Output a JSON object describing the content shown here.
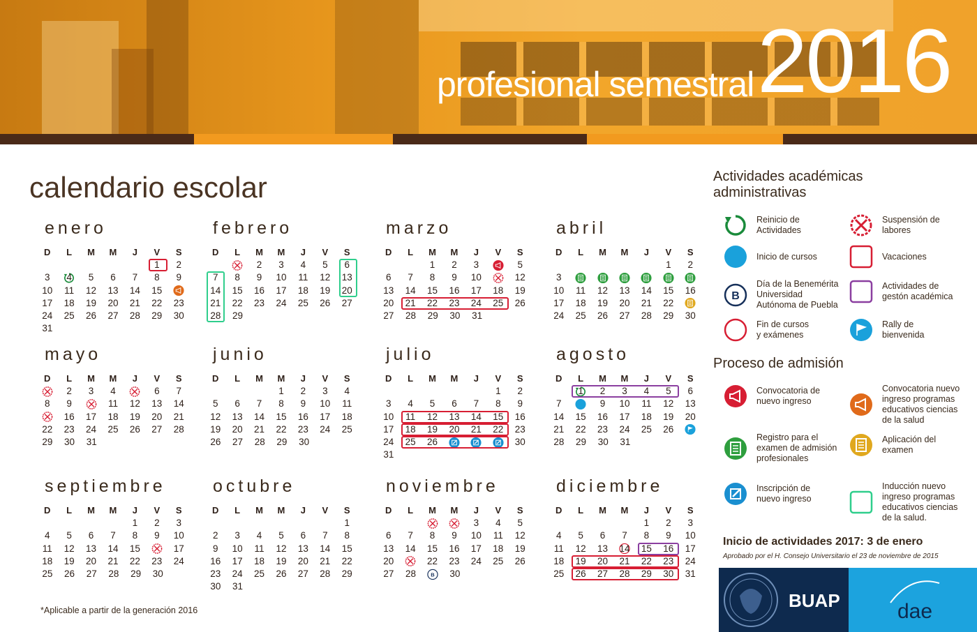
{
  "header": {
    "subtitle": "profesional semestral",
    "year": "2016"
  },
  "calendar_title": "calendario escolar",
  "weekday_headers": [
    "D",
    "L",
    "M",
    "M",
    "J",
    "V",
    "S"
  ],
  "colors": {
    "reinicio": "#1a8b3b",
    "inicio_cursos": "#1aa1db",
    "benemerita": "#16305a",
    "fin_cursos": "#d71e33",
    "suspension": "#d71e33",
    "vacaciones": "#d71e33",
    "gestion": "#8b3fa0",
    "rally": "#1aa1db",
    "convocatoria": "#d71e33",
    "convocatoria_salud": "#e06a1a",
    "registro": "#2e9e3e",
    "aplicacion": "#e0a81e",
    "inscripcion": "#1a8fd0",
    "induccion": "#2fce8c"
  },
  "months": [
    {
      "name": "enero",
      "start": 5,
      "days": 31,
      "marks": {
        "1": "vacaciones-box",
        "4": "reinicio",
        "16": "convocatoria_salud"
      }
    },
    {
      "name": "febrero",
      "start": 1,
      "days": 29,
      "marks": {
        "1": "suspension"
      }
    },
    {
      "name": "marzo",
      "start": 2,
      "days": 31,
      "marks": {
        "4": "convocatoria",
        "11": "suspension"
      }
    },
    {
      "name": "abril",
      "start": 5,
      "days": 30,
      "marks": {
        "4": "registro",
        "5": "registro",
        "6": "registro",
        "7": "registro",
        "8": "registro",
        "9": "registro",
        "23": "aplicacion"
      }
    },
    {
      "name": "mayo",
      "start": 0,
      "days": 31,
      "marks": {
        "1": "suspension",
        "5": "suspension",
        "10": "suspension",
        "15": "suspension"
      }
    },
    {
      "name": "junio",
      "start": 3,
      "days": 30,
      "marks": {}
    },
    {
      "name": "julio",
      "start": 5,
      "days": 31,
      "marks": {
        "27": "inscripcion",
        "28": "inscripcion",
        "29": "inscripcion"
      }
    },
    {
      "name": "agosto",
      "start": 1,
      "days": 31,
      "marks": {
        "1": "reinicio",
        "8": "inicio_cursos",
        "27": "rally"
      }
    },
    {
      "name": "septiembre",
      "start": 4,
      "days": 30,
      "marks": {
        "16": "suspension"
      }
    },
    {
      "name": "octubre",
      "start": 6,
      "days": 31,
      "marks": {}
    },
    {
      "name": "noviembre",
      "start": 2,
      "days": 30,
      "marks": {
        "1": "suspension",
        "2": "suspension",
        "21": "suspension",
        "29": "benemerita"
      }
    },
    {
      "name": "diciembre",
      "start": 4,
      "days": 31,
      "marks": {
        "14": "fin_cursos"
      }
    }
  ],
  "legend": {
    "title": "Actividades académicas administrativas",
    "items": [
      {
        "key": "reinicio",
        "label": "Reinicio de\nActividades",
        "icon": "restart-icon"
      },
      {
        "key": "suspension",
        "label": "Suspensión de\nlabores",
        "icon": "suspension-icon"
      },
      {
        "key": "inicio_cursos",
        "label": "Inicio de cursos",
        "icon": "course-start-icon"
      },
      {
        "key": "vacaciones",
        "label": "Vacaciones",
        "icon": "vacation-icon"
      },
      {
        "key": "benemerita",
        "label": "Día de la Benemérita\nUniversidad\nAutónoma de Puebla",
        "icon": "benemerita-icon"
      },
      {
        "key": "gestion",
        "label": "Actividades de\ngestón académica",
        "icon": "management-icon"
      },
      {
        "key": "fin_cursos",
        "label": "Fin de cursos\ny exámenes",
        "icon": "course-end-icon"
      },
      {
        "key": "rally",
        "label": "Rally de\nbienvenida",
        "icon": "rally-flag-icon"
      }
    ]
  },
  "admission": {
    "title": "Proceso de admisión",
    "items": [
      {
        "key": "convocatoria",
        "label": "Convocatoria de\nnuevo ingreso",
        "icon": "megaphone-icon"
      },
      {
        "key": "convocatoria_salud",
        "label": "Convocatoria nuevo\ningreso programas\neducativos ciencias\nde la salud",
        "icon": "megaphone-health-icon"
      },
      {
        "key": "registro",
        "label": "Registro para el\nexamen de admisión\nprofesionales",
        "icon": "registration-icon"
      },
      {
        "key": "aplicacion",
        "label": "Aplicación del\nexamen",
        "icon": "exam-icon"
      },
      {
        "key": "inscripcion",
        "label": "Inscripción de\nnuevo ingreso",
        "icon": "enrollment-icon"
      },
      {
        "key": "induccion",
        "label": "Inducción nuevo\ningreso programas\neducativos ciencias\nde la salud.",
        "icon": "induction-icon"
      }
    ]
  },
  "footer": {
    "inicio_label": "Inicio de actividades 2017:",
    "inicio_value": "3 de enero",
    "aprobado": "Aprobado por el H. Consejo Universitario el 23 de noviembre de 2015",
    "note": "*Aplicable a partir de la generación 2016",
    "logo_buap": "BUAP",
    "logo_dae": "dae"
  }
}
